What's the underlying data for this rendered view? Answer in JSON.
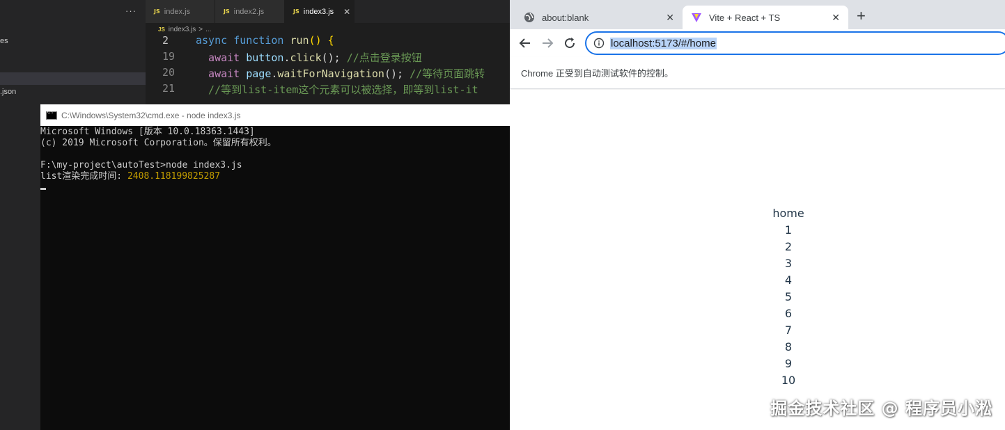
{
  "vscode": {
    "sidebar": {
      "more_label": "···",
      "items": [
        "es",
        ".json"
      ]
    },
    "tabs": [
      {
        "badge": "JS",
        "label": "index.js"
      },
      {
        "badge": "JS",
        "label": "index2.js"
      },
      {
        "badge": "JS",
        "label": "index3.js",
        "close": "✕"
      }
    ],
    "breadcrumb": {
      "badge": "JS",
      "file": "index3.js",
      "sep": ">",
      "rest": "..."
    },
    "code": [
      {
        "num": "2",
        "tokens": [
          [
            "kw",
            "async "
          ],
          [
            "kw",
            "function "
          ],
          [
            "fn",
            "run"
          ],
          [
            "br",
            "() {"
          ]
        ]
      },
      {
        "num": "19",
        "tokens": [
          [
            "aw",
            "  await "
          ],
          [
            "var",
            "button"
          ],
          [
            "pun",
            "."
          ],
          [
            "fn",
            "click"
          ],
          [
            "pun",
            "(); "
          ],
          [
            "cm",
            "//点击登录按钮"
          ]
        ]
      },
      {
        "num": "20",
        "tokens": [
          [
            "aw",
            "  await "
          ],
          [
            "var",
            "page"
          ],
          [
            "pun",
            "."
          ],
          [
            "fn",
            "waitForNavigation"
          ],
          [
            "pun",
            "(); "
          ],
          [
            "cm",
            "//等待页面跳转"
          ]
        ]
      },
      {
        "num": "21",
        "tokens": [
          [
            "cm",
            "  //等到list-item这个元素可以被选择，即等到list-it"
          ]
        ]
      }
    ]
  },
  "cmd": {
    "title": "C:\\Windows\\System32\\cmd.exe - node  index3.js",
    "lines": [
      "Microsoft Windows [版本 10.0.18363.1443]",
      "(c) 2019 Microsoft Corporation。保留所有权利。",
      "",
      "F:\\my-project\\autoTest>node index3.js"
    ],
    "result_label": "list渲染完成时间: ",
    "result_value": "2408.118199825287"
  },
  "chrome": {
    "tabs": [
      {
        "label": "about:blank",
        "icon": "globe-icon",
        "close": "✕"
      },
      {
        "label": "Vite + React + TS",
        "icon": "vite-icon",
        "close": "✕"
      }
    ],
    "new_tab": "+",
    "url": "localhost:5173/#/home",
    "infobar": "Chrome 正受到自动测试软件的控制。",
    "page": {
      "heading": "home",
      "items": [
        "1",
        "2",
        "3",
        "4",
        "5",
        "6",
        "7",
        "8",
        "9",
        "10"
      ]
    }
  },
  "watermark": "掘金技术社区 @ 程序员小淞",
  "colors": {
    "vscode_bg": "#1e1e1e",
    "cmd_bg": "#0c0c0c",
    "chrome_accent": "#1a73e8",
    "cmd_number": "#c19c00"
  }
}
